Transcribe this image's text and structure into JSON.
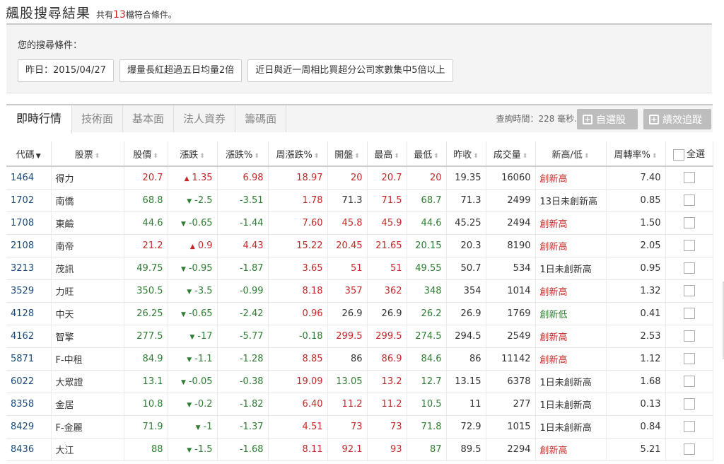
{
  "header": {
    "title": "飆股搜尋結果",
    "sub_prefix": "共有",
    "count": "13",
    "sub_suffix": "檔符合條件。"
  },
  "conditions": {
    "label": "您的搜尋條件：",
    "chips": [
      "昨日：2015/04/27",
      "爆量長紅超過五日均量2倍",
      "近日與近一周相比買超分公司家數集中5倍以上"
    ]
  },
  "tabs": [
    "即時行情",
    "技術面",
    "基本面",
    "法人資券",
    "籌碼面"
  ],
  "query_time": "查詢時間：228 毫秒.",
  "buttons": {
    "favorite": "自選股",
    "performance": "績效追蹤"
  },
  "columns": [
    "代碼",
    "股票",
    "股價",
    "漲跌",
    "漲跌%",
    "周漲跌%",
    "開盤",
    "最高",
    "最低",
    "昨收",
    "成交量",
    "新高/低",
    "周轉率%",
    "全選"
  ],
  "rows": [
    {
      "code": "1464",
      "name": "得力",
      "price": "20.7",
      "chg": "1.35",
      "chg_dir": "up",
      "pct": "6.98",
      "wpct": "18.97",
      "open": "20",
      "high": "20.7",
      "low": "20",
      "prev": "19.35",
      "vol": "16060",
      "hl": "創新高",
      "turn": "7.40"
    },
    {
      "code": "1702",
      "name": "南僑",
      "price": "68.8",
      "chg": "-2.5",
      "chg_dir": "dn",
      "pct": "-3.51",
      "wpct": "1.78",
      "open": "71.3",
      "high": "71.5",
      "low": "68.7",
      "prev": "71.3",
      "vol": "2499",
      "hl": "13日未創新高",
      "turn": "0.85"
    },
    {
      "code": "1708",
      "name": "東鹼",
      "price": "44.6",
      "chg": "-0.65",
      "chg_dir": "dn",
      "pct": "-1.44",
      "wpct": "7.60",
      "open": "45.8",
      "high": "45.9",
      "low": "44.6",
      "prev": "45.25",
      "vol": "2494",
      "hl": "創新高",
      "turn": "1.50"
    },
    {
      "code": "2108",
      "name": "南帝",
      "price": "21.2",
      "chg": "0.9",
      "chg_dir": "up",
      "pct": "4.43",
      "wpct": "15.22",
      "open": "20.45",
      "high": "21.65",
      "low": "20.15",
      "prev": "20.3",
      "vol": "8190",
      "hl": "創新高",
      "turn": "2.05"
    },
    {
      "code": "3213",
      "name": "茂訊",
      "price": "49.75",
      "chg": "-0.95",
      "chg_dir": "dn",
      "pct": "-1.87",
      "wpct": "3.65",
      "open": "51",
      "high": "51",
      "low": "49.55",
      "prev": "50.7",
      "vol": "534",
      "hl": "1日未創新高",
      "turn": "0.95"
    },
    {
      "code": "3529",
      "name": "力旺",
      "price": "350.5",
      "chg": "-3.5",
      "chg_dir": "dn",
      "pct": "-0.99",
      "wpct": "8.18",
      "open": "357",
      "high": "362",
      "low": "348",
      "prev": "354",
      "vol": "1014",
      "hl": "創新高",
      "turn": "1.32"
    },
    {
      "code": "4128",
      "name": "中天",
      "price": "26.25",
      "chg": "-0.65",
      "chg_dir": "dn",
      "pct": "-2.42",
      "wpct": "0.96",
      "open": "26.9",
      "high": "26.9",
      "low": "26.2",
      "prev": "26.9",
      "vol": "1769",
      "hl": "創新低",
      "turn": "0.41"
    },
    {
      "code": "4162",
      "name": "智擎",
      "price": "277.5",
      "chg": "-17",
      "chg_dir": "dn",
      "pct": "-5.77",
      "wpct": "-0.18",
      "open": "299.5",
      "high": "299.5",
      "low": "274.5",
      "prev": "294.5",
      "vol": "2549",
      "hl": "創新高",
      "turn": "2.53"
    },
    {
      "code": "5871",
      "name": "F-中租",
      "price": "84.9",
      "chg": "-1.1",
      "chg_dir": "dn",
      "pct": "-1.28",
      "wpct": "8.85",
      "open": "86",
      "high": "86.9",
      "low": "84.6",
      "prev": "86",
      "vol": "11142",
      "hl": "創新高",
      "turn": "1.12"
    },
    {
      "code": "6022",
      "name": "大眾證",
      "price": "13.1",
      "chg": "-0.05",
      "chg_dir": "dn",
      "pct": "-0.38",
      "wpct": "19.09",
      "open": "13.05",
      "high": "13.2",
      "low": "12.7",
      "prev": "13.15",
      "vol": "6378",
      "hl": "1日未創新高",
      "turn": "1.68"
    },
    {
      "code": "8358",
      "name": "金居",
      "price": "10.8",
      "chg": "-0.2",
      "chg_dir": "dn",
      "pct": "-1.82",
      "wpct": "6.40",
      "open": "11.2",
      "high": "11.2",
      "low": "10.5",
      "prev": "11",
      "vol": "277",
      "hl": "1日未創新高",
      "turn": "0.13"
    },
    {
      "code": "8429",
      "name": "F-金麗",
      "price": "71.9",
      "chg": "-1",
      "chg_dir": "dn",
      "pct": "-1.37",
      "wpct": "4.51",
      "open": "73",
      "high": "73",
      "low": "71.8",
      "prev": "72.9",
      "vol": "1015",
      "hl": "1日未創新高",
      "turn": "0.84"
    },
    {
      "code": "8436",
      "name": "大江",
      "price": "88",
      "chg": "-1.5",
      "chg_dir": "dn",
      "pct": "-1.68",
      "wpct": "8.11",
      "open": "92.1",
      "high": "93",
      "low": "87",
      "prev": "89.5",
      "vol": "2294",
      "hl": "創新高",
      "turn": "5.21"
    }
  ],
  "colors": {
    "up": "#c62828",
    "down": "#2e7d32",
    "link": "#1a4a7a"
  }
}
